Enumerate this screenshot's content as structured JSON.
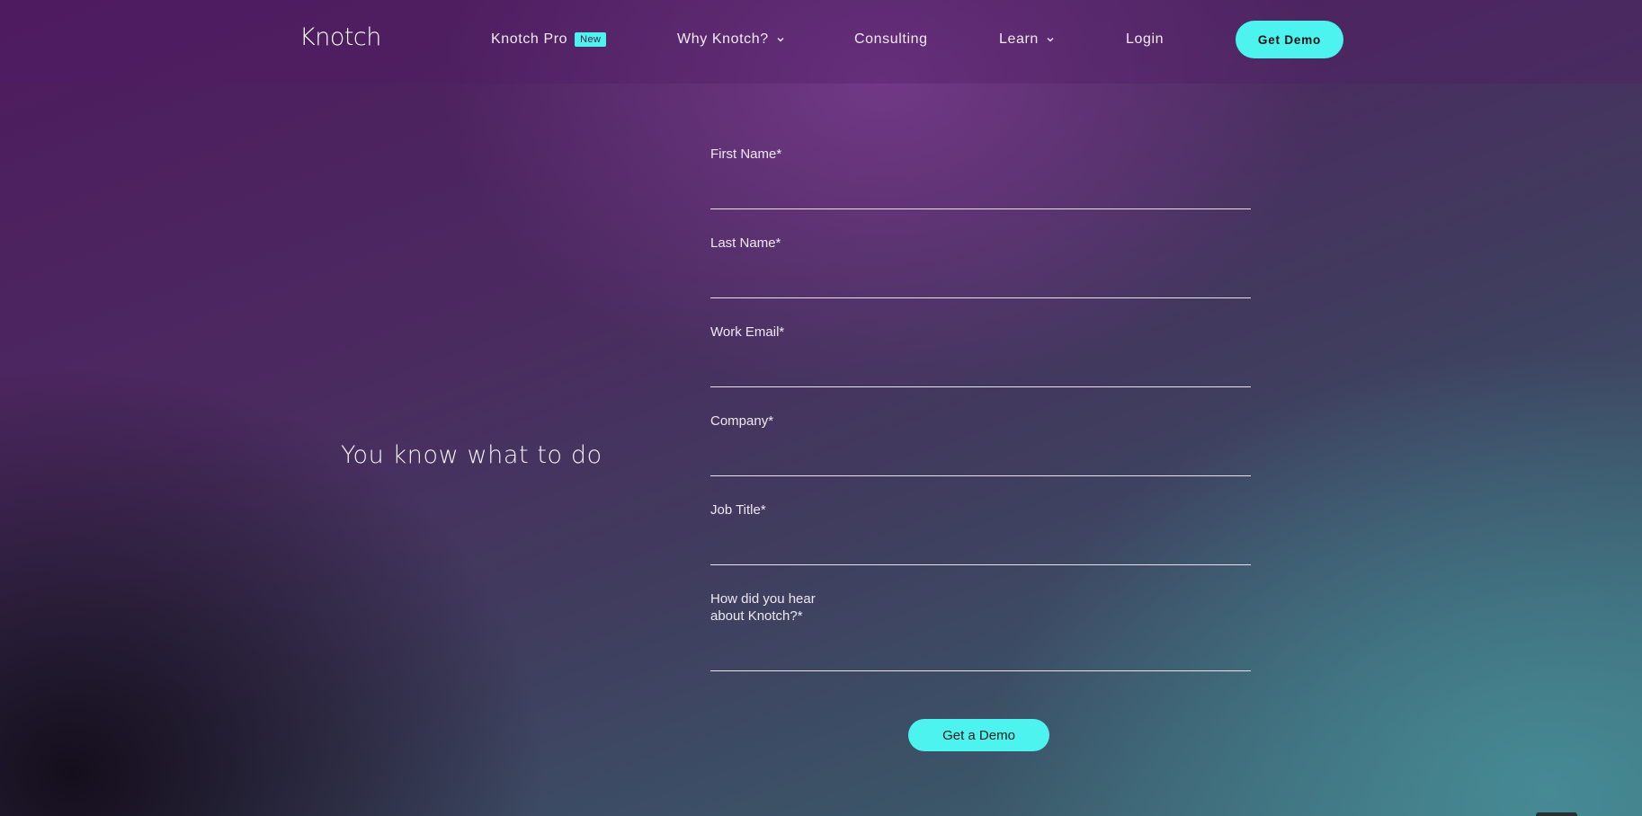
{
  "header": {
    "logo": "Knotch",
    "nav": [
      {
        "label": "Knotch Pro",
        "badge": "New"
      },
      {
        "label": "Why Knotch?",
        "icon": "chevron-down-icon"
      },
      {
        "label": "Consulting"
      },
      {
        "label": "Learn",
        "icon": "chevron-down-icon"
      },
      {
        "label": "Login"
      }
    ],
    "cta_label": "Get Demo"
  },
  "main": {
    "headline": "You know what to do",
    "form": {
      "fields": [
        {
          "label": "First Name*",
          "value": ""
        },
        {
          "label": "Last Name*",
          "value": ""
        },
        {
          "label": "Work Email*",
          "value": ""
        },
        {
          "label": "Company*",
          "value": ""
        },
        {
          "label": "Job Title*",
          "value": ""
        },
        {
          "label_line1": "How did you hear",
          "label_line2": "about Knotch?*",
          "value": ""
        }
      ],
      "submit_label": "Get a Demo"
    }
  },
  "colors": {
    "accent": "#4cf3ef",
    "bg_purple": "#4e1a5e",
    "bg_teal": "#3f6c78"
  }
}
